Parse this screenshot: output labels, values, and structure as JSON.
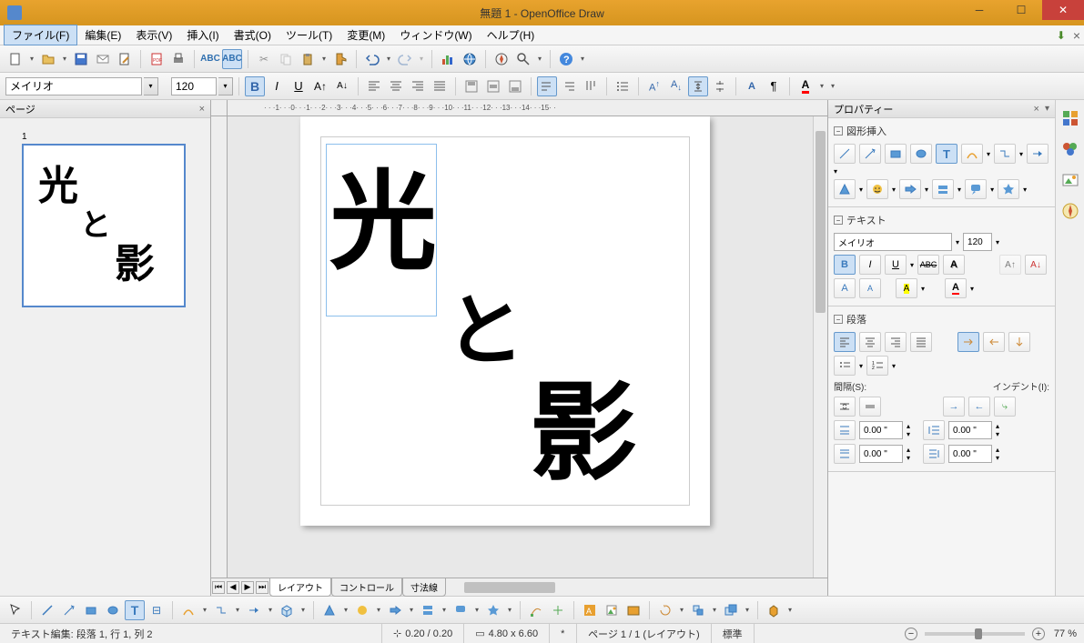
{
  "window": {
    "title": "無題 1 - OpenOffice Draw"
  },
  "menu": {
    "file": "ファイル(F)",
    "edit": "編集(E)",
    "view": "表示(V)",
    "insert": "挿入(I)",
    "format": "書式(O)",
    "tools": "ツール(T)",
    "modify": "変更(M)",
    "window": "ウィンドウ(W)",
    "help": "ヘルプ(H)"
  },
  "formatting": {
    "font_name": "メイリオ",
    "font_size": "120"
  },
  "pages_panel": {
    "title": "ページ",
    "page_number": "1",
    "thumb": {
      "t1": "光",
      "t2": "と",
      "t3": "影"
    }
  },
  "canvas": {
    "text1": "光",
    "text2": "と",
    "text3": "影"
  },
  "tabs": {
    "layout": "レイアウト",
    "controls": "コントロール",
    "dimlines": "寸法線"
  },
  "properties": {
    "title": "プロパティー",
    "shapes_section": "図形挿入",
    "text_section": "テキスト",
    "font_name": "メイリオ",
    "font_size": "120",
    "paragraph_section": "段落",
    "spacing_label": "間隔(S):",
    "indent_label": "インデント(I):",
    "val1": "0.00 \"",
    "val2": "0.00 \"",
    "val3": "0.00 \"",
    "val4": "0.00 \""
  },
  "status": {
    "edit_mode": "テキスト編集: 段落 1, 行 1, 列 2",
    "pos": "0.20 / 0.20",
    "size": "4.80 x 6.60",
    "page": "ページ 1 / 1 (レイアウト)",
    "style": "標準",
    "zoom": "77 %"
  }
}
